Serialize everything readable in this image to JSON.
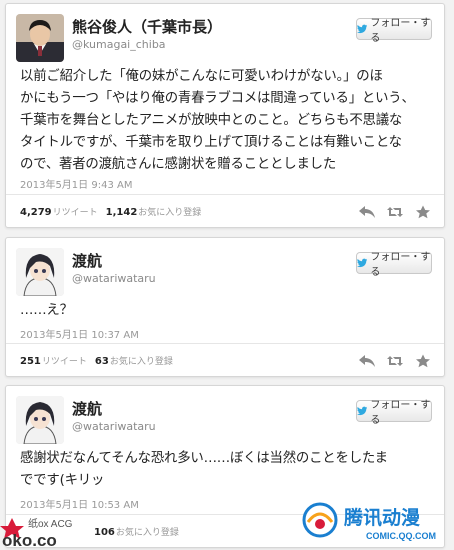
{
  "follow_label": "フォロー・する",
  "tweets": [
    {
      "name": "熊谷俊人（千葉市長）",
      "handle": "@kumagai_chiba",
      "lines": [
        "以前ご紹介した「俺の妹がこんなに可愛いわけがない。」のほ",
        "かにもう一つ「やはり俺の青春ラブコメは間違っている」という、",
        "千葉市を舞台としたアニメが放映中とのこと。どちらも不思議な",
        "タイトルですが、千葉市を取り上げて頂けることは有難いことな",
        "ので、著者の渡航さんに感謝状を贈ることとしました"
      ],
      "timestamp": "2013年5月1日 9:43 AM",
      "retweets": "4,279",
      "retweets_label": "リツイート",
      "favorites": "1,142",
      "favorites_label": "お気に入り登録"
    },
    {
      "name": "渡航",
      "handle": "@watariwataru",
      "lines": [
        "……え？"
      ],
      "timestamp": "2013年5月1日 10:37 AM",
      "retweets": "251",
      "retweets_label": "リツイート",
      "favorites": "63",
      "favorites_label": "お気に入り登録"
    },
    {
      "name": "渡航",
      "handle": "@watariwataru",
      "lines": [
        "感謝状だなんてそんな恐れ多い……ぼくは当然のことをしたま",
        "でです(キリッ"
      ],
      "timestamp": "2013年5月1日 10:53 AM",
      "favorites": "106",
      "favorites_label": "お気に入り登録"
    }
  ],
  "watermarks": {
    "left_top": "纸ox ACG",
    "left_bottom": "oko.co",
    "right_brand": "腾讯动漫",
    "right_url": "COMIC.QQ.COM"
  },
  "colors": {
    "twitter_blue": "#2fa9e0",
    "text": "#222222",
    "muted": "#999999",
    "watermark_blue": "#1a7fd0"
  }
}
